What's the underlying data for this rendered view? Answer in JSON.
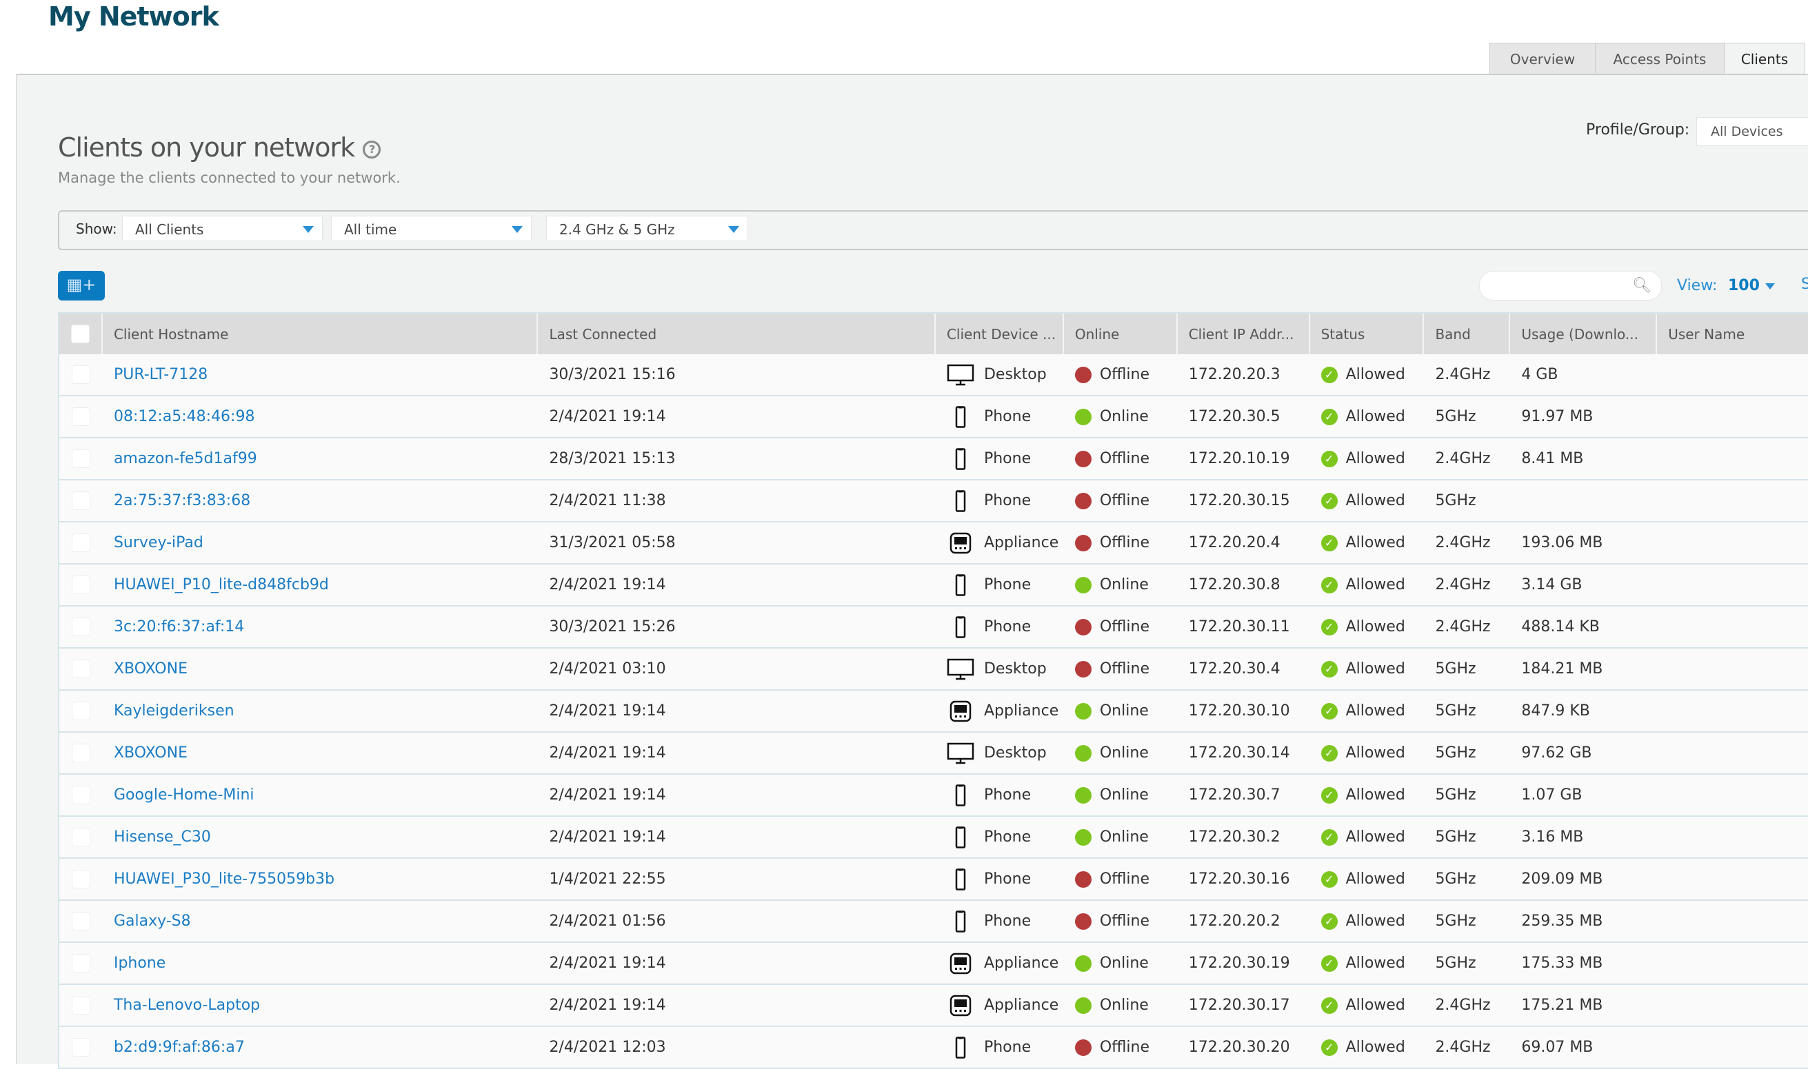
{
  "header": {
    "title": "My Network",
    "tabs": [
      {
        "label": "Overview"
      },
      {
        "label": "Access Points"
      },
      {
        "label": "Clients",
        "active": true
      }
    ]
  },
  "page": {
    "title": "Clients on your network",
    "help_icon": "help-circle-icon",
    "subtitle": "Manage the clients connected to your network.",
    "profile_label": "Profile/Group:",
    "profile_value": "All Devices"
  },
  "filters": {
    "show_label": "Show:",
    "client_filter": "All Clients",
    "time_filter": "All time",
    "band_filter": "2.4 GHz & 5 GHz"
  },
  "toolbar": {
    "columns_button_icon": "table-add-column-icon",
    "search_value": "",
    "view_label": "View:",
    "view_value": "100",
    "edge_text": "S"
  },
  "colors": {
    "accent": "#0a7bc1",
    "link": "#1a7cc4",
    "online": "#7cc61e",
    "offline": "#b53a3a",
    "allowed": "#7cc61e",
    "title": "#0d4d63"
  },
  "table": {
    "columns": [
      "Client Hostname",
      "Last Connected",
      "Client Device ...",
      "Online",
      "Client IP Addr...",
      "Status",
      "Band",
      "Usage (Downlo...",
      "User Name"
    ],
    "rows": [
      {
        "host": "PUR-LT-7128",
        "last": "30/3/2021 15:16",
        "device": "Desktop",
        "online": "Offline",
        "ip": "172.20.20.3",
        "status": "Allowed",
        "band": "2.4GHz",
        "usage": "4 GB",
        "user": ""
      },
      {
        "host": "08:12:a5:48:46:98",
        "last": "2/4/2021 19:14",
        "device": "Phone",
        "online": "Online",
        "ip": "172.20.30.5",
        "status": "Allowed",
        "band": "5GHz",
        "usage": "91.97 MB",
        "user": ""
      },
      {
        "host": "amazon-fe5d1af99",
        "last": "28/3/2021 15:13",
        "device": "Phone",
        "online": "Offline",
        "ip": "172.20.10.19",
        "status": "Allowed",
        "band": "2.4GHz",
        "usage": "8.41 MB",
        "user": ""
      },
      {
        "host": "2a:75:37:f3:83:68",
        "last": "2/4/2021 11:38",
        "device": "Phone",
        "online": "Offline",
        "ip": "172.20.30.15",
        "status": "Allowed",
        "band": "5GHz",
        "usage": "",
        "user": ""
      },
      {
        "host": "Survey-iPad",
        "last": "31/3/2021 05:58",
        "device": "Appliance",
        "online": "Offline",
        "ip": "172.20.20.4",
        "status": "Allowed",
        "band": "2.4GHz",
        "usage": "193.06 MB",
        "user": ""
      },
      {
        "host": "HUAWEI_P10_lite-d848fcb9d",
        "last": "2/4/2021 19:14",
        "device": "Phone",
        "online": "Online",
        "ip": "172.20.30.8",
        "status": "Allowed",
        "band": "2.4GHz",
        "usage": "3.14 GB",
        "user": ""
      },
      {
        "host": "3c:20:f6:37:af:14",
        "last": "30/3/2021 15:26",
        "device": "Phone",
        "online": "Offline",
        "ip": "172.20.30.11",
        "status": "Allowed",
        "band": "2.4GHz",
        "usage": "488.14 KB",
        "user": ""
      },
      {
        "host": "XBOXONE",
        "last": "2/4/2021 03:10",
        "device": "Desktop",
        "online": "Offline",
        "ip": "172.20.30.4",
        "status": "Allowed",
        "band": "5GHz",
        "usage": "184.21 MB",
        "user": ""
      },
      {
        "host": "Kayleigderiksen",
        "last": "2/4/2021 19:14",
        "device": "Appliance",
        "online": "Online",
        "ip": "172.20.30.10",
        "status": "Allowed",
        "band": "5GHz",
        "usage": "847.9 KB",
        "user": ""
      },
      {
        "host": "XBOXONE",
        "last": "2/4/2021 19:14",
        "device": "Desktop",
        "online": "Online",
        "ip": "172.20.30.14",
        "status": "Allowed",
        "band": "5GHz",
        "usage": "97.62 GB",
        "user": ""
      },
      {
        "host": "Google-Home-Mini",
        "last": "2/4/2021 19:14",
        "device": "Phone",
        "online": "Online",
        "ip": "172.20.30.7",
        "status": "Allowed",
        "band": "5GHz",
        "usage": "1.07 GB",
        "user": ""
      },
      {
        "host": "Hisense_C30",
        "last": "2/4/2021 19:14",
        "device": "Phone",
        "online": "Online",
        "ip": "172.20.30.2",
        "status": "Allowed",
        "band": "5GHz",
        "usage": "3.16 MB",
        "user": ""
      },
      {
        "host": "HUAWEI_P30_lite-755059b3b",
        "last": "1/4/2021 22:55",
        "device": "Phone",
        "online": "Offline",
        "ip": "172.20.30.16",
        "status": "Allowed",
        "band": "5GHz",
        "usage": "209.09 MB",
        "user": ""
      },
      {
        "host": "Galaxy-S8",
        "last": "2/4/2021 01:56",
        "device": "Phone",
        "online": "Offline",
        "ip": "172.20.20.2",
        "status": "Allowed",
        "band": "5GHz",
        "usage": "259.35 MB",
        "user": ""
      },
      {
        "host": "Iphone",
        "last": "2/4/2021 19:14",
        "device": "Appliance",
        "online": "Online",
        "ip": "172.20.30.19",
        "status": "Allowed",
        "band": "5GHz",
        "usage": "175.33 MB",
        "user": ""
      },
      {
        "host": "Tha-Lenovo-Laptop",
        "last": "2/4/2021 19:14",
        "device": "Appliance",
        "online": "Online",
        "ip": "172.20.30.17",
        "status": "Allowed",
        "band": "2.4GHz",
        "usage": "175.21 MB",
        "user": ""
      },
      {
        "host": "b2:d9:9f:af:86:a7",
        "last": "2/4/2021 12:03",
        "device": "Phone",
        "online": "Offline",
        "ip": "172.20.30.20",
        "status": "Allowed",
        "band": "2.4GHz",
        "usage": "69.07 MB",
        "user": ""
      }
    ]
  }
}
